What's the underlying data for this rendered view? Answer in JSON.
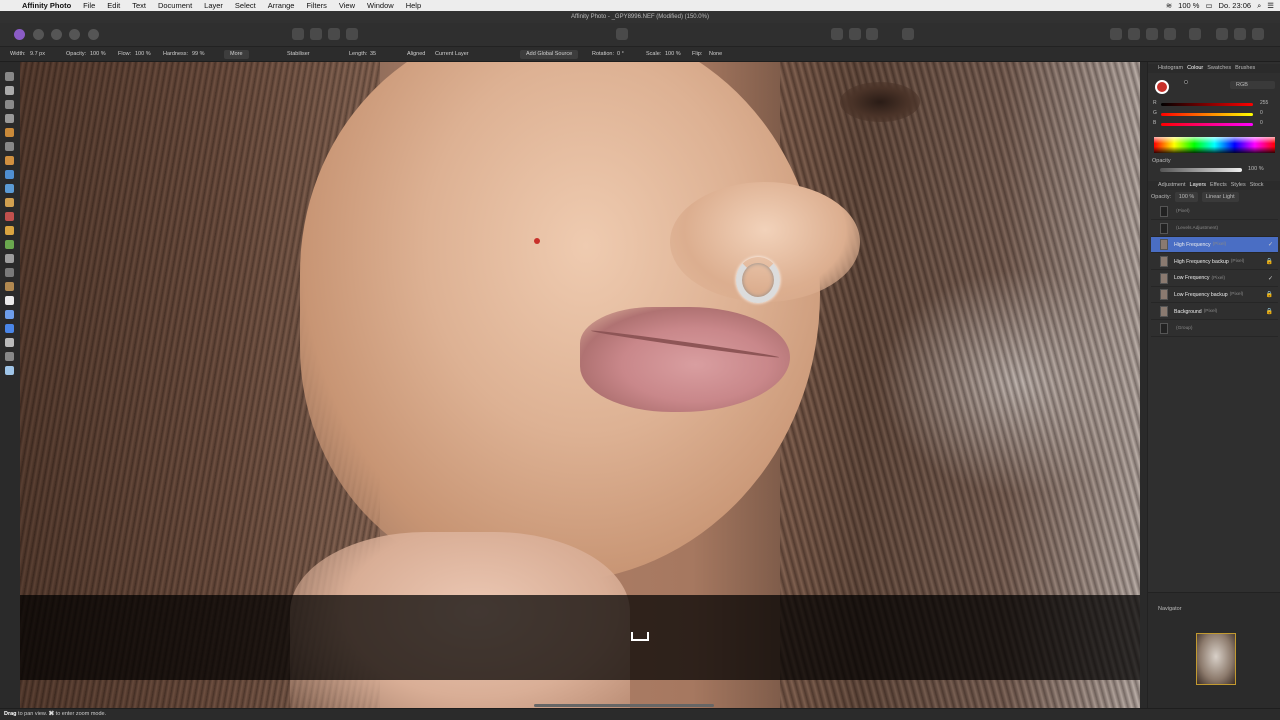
{
  "menubar": {
    "app_name": "Affinity Photo",
    "items": [
      "File",
      "Edit",
      "Text",
      "Document",
      "Layer",
      "Select",
      "Arrange",
      "Filters",
      "View",
      "Window",
      "Help"
    ],
    "battery": "100 %",
    "clock": "Do. 23:06"
  },
  "window": {
    "title": "Affinity Photo - _GPY8996.NEF (Modified) (150.0%)"
  },
  "context_toolbar": {
    "width_label": "Width:",
    "width_value": "9.7 px",
    "opacity_label": "Opacity:",
    "opacity_value": "100 %",
    "flow_label": "Flow:",
    "flow_value": "100 %",
    "hardness_label": "Hardness:",
    "hardness_value": "99 %",
    "more_label": "More",
    "stabiliser_label": "Stabiliser",
    "length_label": "Length:",
    "length_value": "35",
    "aligned_label": "Aligned",
    "source_value": "Current Layer",
    "add_global_source_label": "Add Global Source",
    "rotation_label": "Rotation:",
    "rotation_value": "0 °",
    "scale_label": "Scale:",
    "scale_value": "100 %",
    "flip_label": "Flip:",
    "flip_value": "None"
  },
  "colour_panel": {
    "tabs": [
      "Histogram",
      "Colour",
      "Swatches",
      "Brushes"
    ],
    "active_tab": "Colour",
    "model": "RGB",
    "channels": [
      {
        "label": "R",
        "value": "255"
      },
      {
        "label": "G",
        "value": "0"
      },
      {
        "label": "B",
        "value": "0"
      }
    ],
    "opacity_label": "Opacity",
    "opacity_value": "100 %",
    "foreground_color": "#c8302a"
  },
  "layers_panel": {
    "tabs": [
      "Adjustment",
      "Layers",
      "Effects",
      "Styles",
      "Stock"
    ],
    "active_tab": "Layers",
    "opacity_label": "Opacity:",
    "opacity_value": "100 %",
    "blend_mode": "Linear Light",
    "layers": [
      {
        "name": "",
        "type": "(Pixel)",
        "dim": true,
        "selected": false,
        "flag": ""
      },
      {
        "name": "",
        "type": "(Levels Adjustment)",
        "dim": true,
        "selected": false,
        "flag": ""
      },
      {
        "name": "High Frequency",
        "type": "(Pixel)",
        "dim": false,
        "selected": true,
        "flag": "✓"
      },
      {
        "name": "High Frequency backup",
        "type": "(Pixel)",
        "dim": false,
        "selected": false,
        "flag": "🔒"
      },
      {
        "name": "Low Frequency",
        "type": "(Pixel)",
        "dim": false,
        "selected": false,
        "flag": "✓"
      },
      {
        "name": "Low Frequency backup",
        "type": "(Pixel)",
        "dim": false,
        "selected": false,
        "flag": "🔒"
      },
      {
        "name": "Background",
        "type": "(Pixel)",
        "dim": false,
        "selected": false,
        "flag": "🔒"
      },
      {
        "name": "",
        "type": "(Group)",
        "dim": true,
        "selected": false,
        "flag": ""
      }
    ]
  },
  "navigator": {
    "label": "Navigator"
  },
  "statusbar": {
    "bold1": "Drag",
    "text1": " to pan view. ",
    "bold2": "⌘",
    "text2": " to enter zoom mode."
  }
}
